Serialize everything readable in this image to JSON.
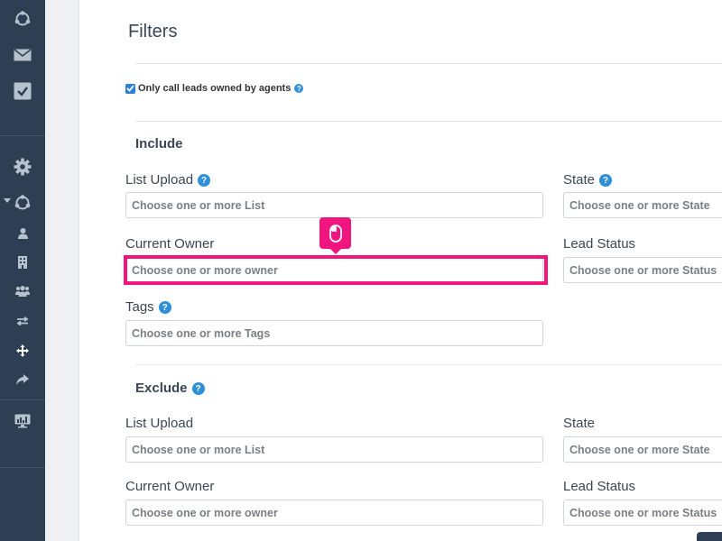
{
  "page": {
    "title": "Filters",
    "only_owned_label": "Only call leads owned by agents",
    "help_glyph": "?"
  },
  "include": {
    "heading": "Include",
    "list_upload": {
      "label": "List Upload",
      "placeholder": "Choose one or more List"
    },
    "state": {
      "label": "State",
      "placeholder": "Choose one or more State"
    },
    "current_owner": {
      "label": "Current Owner",
      "placeholder": "Choose one or more owner"
    },
    "lead_status": {
      "label": "Lead Status",
      "placeholder": "Choose one or more Status"
    },
    "tags": {
      "label": "Tags",
      "placeholder": "Choose one or more Tags"
    }
  },
  "exclude": {
    "heading": "Exclude",
    "list_upload": {
      "label": "List Upload",
      "placeholder": "Choose one or more List"
    },
    "state": {
      "label": "State",
      "placeholder": "Choose one or more State"
    },
    "current_owner": {
      "label": "Current Owner",
      "placeholder": "Choose one or more owner"
    },
    "lead_status": {
      "label": "Lead Status",
      "placeholder": "Choose one or more Status"
    }
  },
  "sidebar": {
    "icons": [
      "network-icon",
      "mail-icon",
      "checklist-icon",
      "gear-icon",
      "network-icon",
      "user-icon",
      "building-icon",
      "group-icon",
      "transfer-icon",
      "move-icon",
      "share-icon",
      "monitor-icon"
    ]
  },
  "colors": {
    "sidebar": "#2e3f54",
    "accent": "#2f8fd9",
    "highlight": "#f0157f"
  }
}
